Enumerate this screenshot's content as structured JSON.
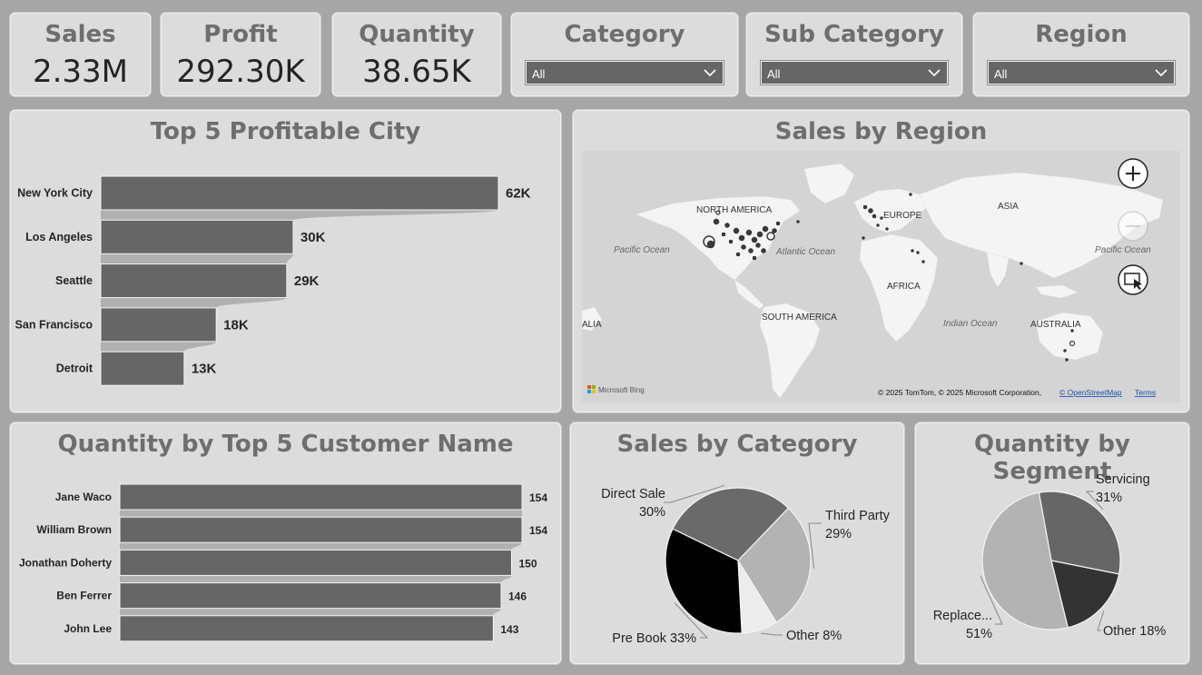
{
  "kpis": [
    {
      "label": "Sales",
      "value": "2.33M"
    },
    {
      "label": "Profit",
      "value": "292.30K"
    },
    {
      "label": "Quantity",
      "value": "38.65K"
    }
  ],
  "slicers": [
    {
      "label": "Category",
      "value": "All"
    },
    {
      "label": "Sub Category",
      "value": "All"
    },
    {
      "label": "Region",
      "value": "All"
    }
  ],
  "visuals": {
    "top_city_title": "Top 5 Profitable City",
    "region_title": "Sales by Region",
    "customer_title": "Quantity by Top 5 Customer Name",
    "category_title": "Sales by Category",
    "segment_title": "Quantity by Segment"
  },
  "map": {
    "labels": {
      "north_america": "NORTH AMERICA",
      "europe": "EUROPE",
      "asia": "ASIA",
      "africa": "AFRICA",
      "south_america": "SOUTH AMERICA",
      "australia": "AUSTRALIA",
      "alia": "ALIA",
      "pacific_ocean_left": "Pacific Ocean",
      "atlantic_ocean": "Atlantic Ocean",
      "indian_ocean": "Indian Ocean",
      "pacific_ocean_right": "Pacific Ocean"
    },
    "logo_text": "Microsoft Bing",
    "attribution": "© 2025 TomTom, © 2025 Microsoft Corporation,",
    "osm_link": "© OpenStreetMap",
    "terms_link": "Terms",
    "colors": {
      "land": "#f4f4f4",
      "water": "#d4d4d4",
      "dot": "#3a3a3a"
    }
  },
  "chart_data": [
    {
      "type": "bar",
      "orientation": "horizontal",
      "title": "Top 5 Profitable City",
      "categories": [
        "New York City",
        "Los Angeles",
        "Seattle",
        "San Francisco",
        "Detroit"
      ],
      "values": [
        62,
        30,
        29,
        18,
        13
      ],
      "value_labels": [
        "62K",
        "30K",
        "29K",
        "18K",
        "13K"
      ],
      "xlim": [
        0,
        62
      ]
    },
    {
      "type": "bar",
      "orientation": "horizontal",
      "title": "Quantity by Top 5 Customer Name",
      "categories": [
        "Jane Waco",
        "William Brown",
        "Jonathan Doherty",
        "Ben Ferrer",
        "John Lee"
      ],
      "values": [
        154,
        154,
        150,
        146,
        143
      ],
      "value_labels": [
        "154",
        "154",
        "150",
        "146",
        "143"
      ],
      "xlim": [
        0,
        154
      ]
    },
    {
      "type": "pie",
      "title": "Sales by Category",
      "slices": [
        {
          "label": "Direct Sale",
          "value": 30,
          "pct_label": "30%",
          "color": "#6a6a6a"
        },
        {
          "label": "Third Party",
          "value": 29,
          "pct_label": "29%",
          "color": "#b3b3b3"
        },
        {
          "label": "Other",
          "value": 8,
          "pct_label": "8%",
          "color": "#ececec"
        },
        {
          "label": "Pre Book",
          "value": 33,
          "pct_label": "33%",
          "color": "#000000"
        }
      ]
    },
    {
      "type": "pie",
      "title": "Quantity by Segment",
      "slices": [
        {
          "label": "Servicing",
          "value": 31,
          "pct_label": "31%",
          "color": "#666666"
        },
        {
          "label": "Other",
          "value": 18,
          "pct_label": "18%",
          "color": "#333333"
        },
        {
          "label": "Replace...",
          "value": 51,
          "pct_label": "51%",
          "color": "#b3b3b3"
        }
      ]
    }
  ],
  "colors": {
    "bar": "#666666",
    "card_bg": "#dcdcdc",
    "title": "#6e6e6e",
    "page_bg": "#a6a6a6"
  }
}
